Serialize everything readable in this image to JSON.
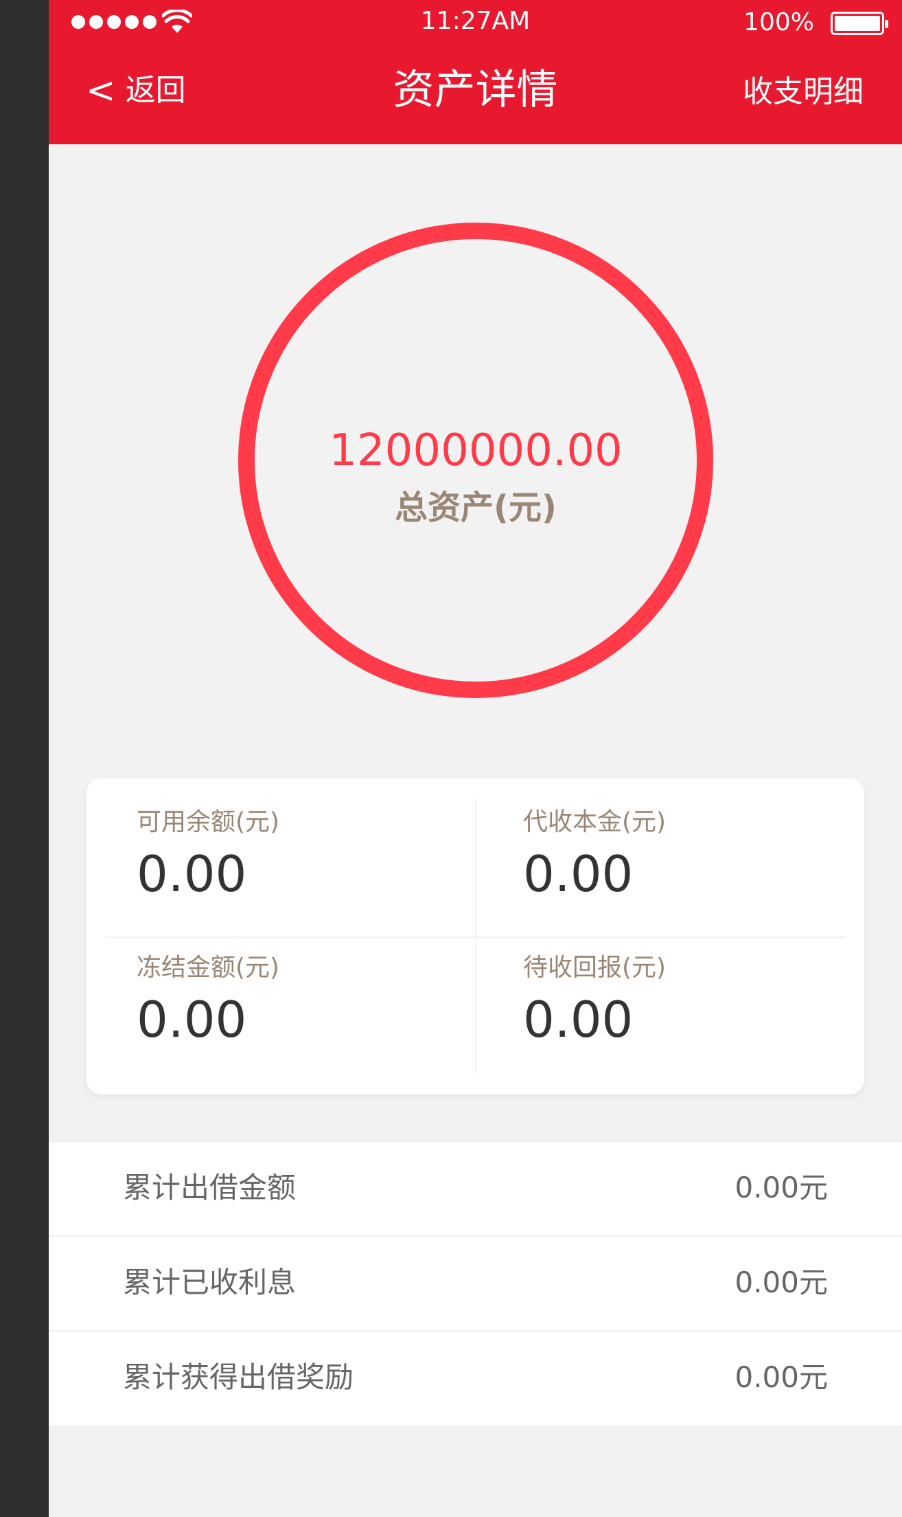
{
  "status_bar": {
    "time": "11:27AM",
    "battery": "100%"
  },
  "nav": {
    "back_label": "返回",
    "title": "资产详情",
    "right_label": "收支明细"
  },
  "asset": {
    "amount": "12000000.00",
    "label": "总资产(元)",
    "ring_color": "#ff3a49",
    "amount_color": "#ff3a49",
    "label_color": "#998675"
  },
  "stats": [
    {
      "label": "可用余额(元)",
      "value": "0.00"
    },
    {
      "label": "代收本金(元)",
      "value": "0.00"
    },
    {
      "label": "冻结金额(元)",
      "value": "0.00"
    },
    {
      "label": "待收回报(元)",
      "value": "0.00"
    }
  ],
  "summary": [
    {
      "label": "累计出借金额",
      "value": "0.00元"
    },
    {
      "label": "累计已收利息",
      "value": "0.00元"
    },
    {
      "label": "累计获得出借奖励",
      "value": "0.00元"
    }
  ],
  "colors": {
    "header": "#e8182f",
    "background": "#f2f2f2",
    "divider": "#f2f2f2"
  }
}
